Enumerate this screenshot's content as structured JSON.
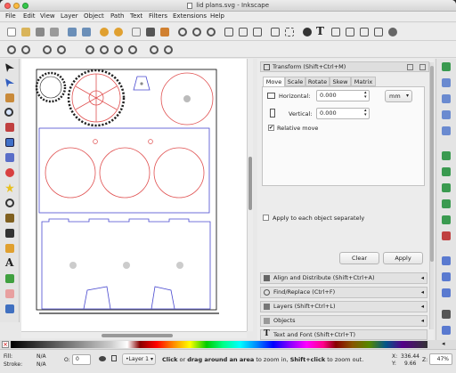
{
  "window": {
    "title": "lid plans.svg - Inkscape"
  },
  "menu": [
    "File",
    "Edit",
    "View",
    "Layer",
    "Object",
    "Path",
    "Text",
    "Filters",
    "Extensions",
    "Help"
  ],
  "transform": {
    "title": "Transform (Shift+Ctrl+M)",
    "tabs": [
      "Move",
      "Scale",
      "Rotate",
      "Skew",
      "Matrix"
    ],
    "horizontal_label": "Horizontal:",
    "horizontal_value": "0.000",
    "vertical_label": "Vertical:",
    "vertical_value": "0.000",
    "unit": "mm",
    "relative_move": "Relative move",
    "apply_each": "Apply to each object separately",
    "clear": "Clear",
    "apply": "Apply"
  },
  "panels": [
    "Align and Distribute (Shift+Ctrl+A)",
    "Find/Replace (Ctrl+F)",
    "Layers (Shift+Ctrl+L)",
    "Objects",
    "Text and Font (Shift+Ctrl+T)"
  ],
  "status": {
    "fill_label": "Fill:",
    "fill_value": "N/A",
    "stroke_label": "Stroke:",
    "stroke_value": "N/A",
    "opacity_label": "O:",
    "opacity_value": "0",
    "layer": "•Layer 1",
    "msg_1": "Click",
    "msg_2": " or ",
    "msg_3": "drag around an area",
    "msg_4": " to zoom in, ",
    "msg_5": "Shift+click",
    "msg_6": " to zoom out.",
    "x_label": "X:",
    "x_value": "336.44",
    "y_label": "Y:",
    "y_value": "9.66",
    "z_label": "Z:",
    "zoom": "47%"
  },
  "colors": {
    "accent_red": "#e05050",
    "accent_blue": "#4a4ad0"
  }
}
